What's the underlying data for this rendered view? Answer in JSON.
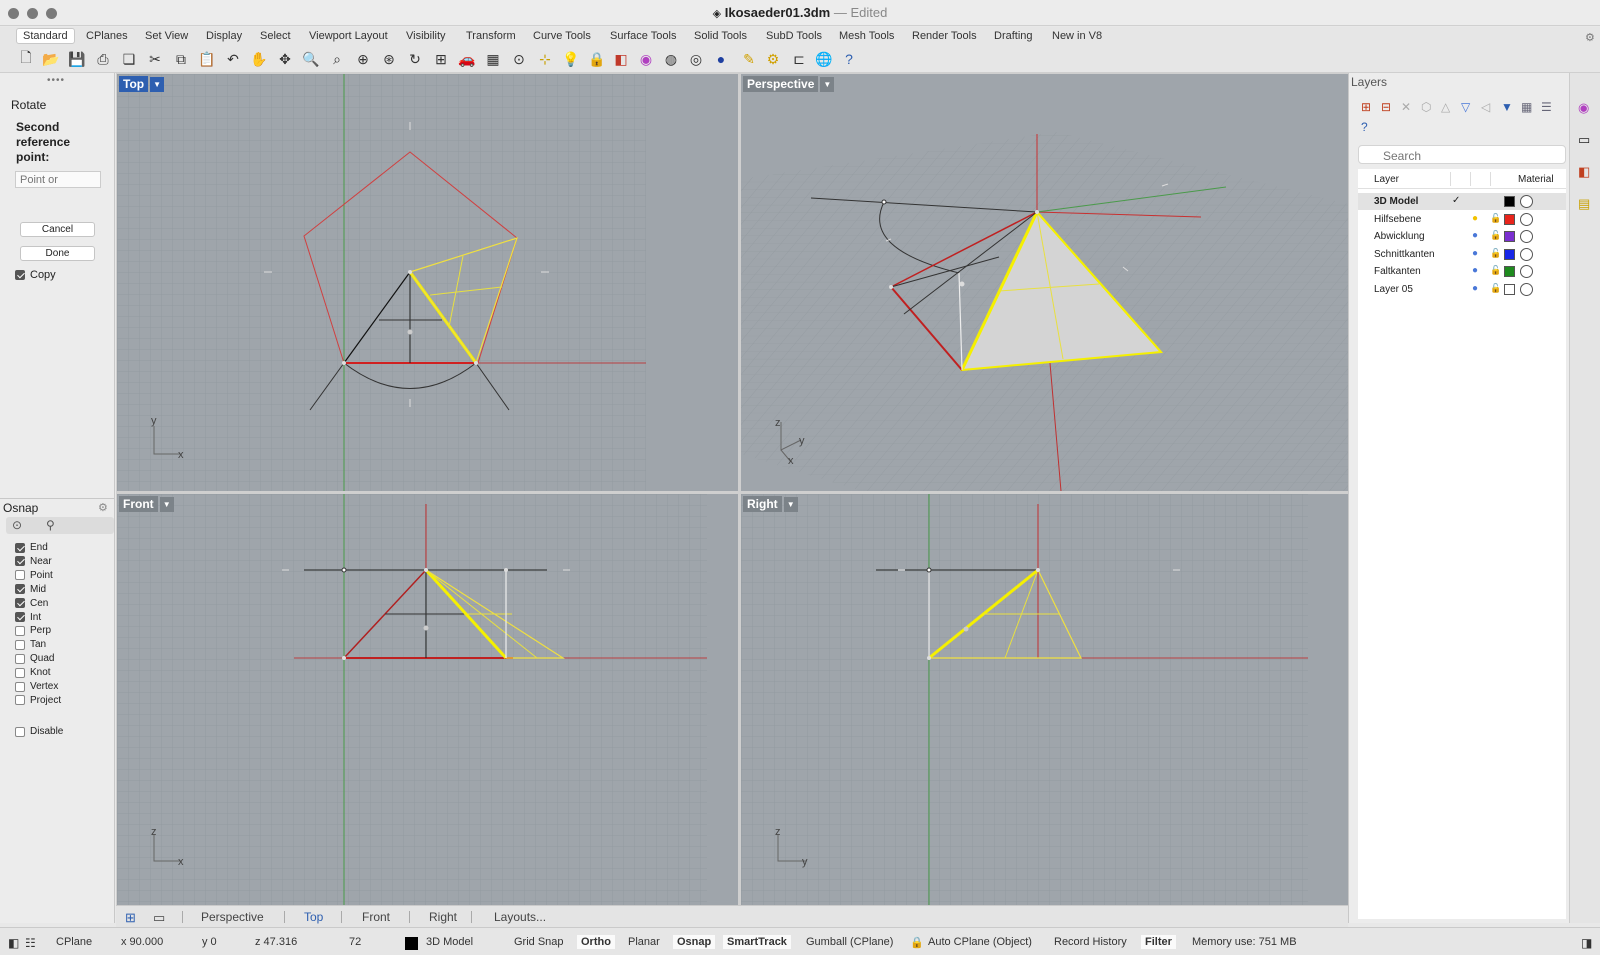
{
  "window": {
    "title": "Ikosaeder01.3dm",
    "edited": "— Edited"
  },
  "tabs": [
    "Standard",
    "CPlanes",
    "Set View",
    "Display",
    "Select",
    "Viewport Layout",
    "Visibility",
    "Transform",
    "Curve Tools",
    "Surface Tools",
    "Solid Tools",
    "SubD Tools",
    "Mesh Tools",
    "Render Tools",
    "Drafting",
    "New in V8"
  ],
  "command": {
    "name": "Rotate",
    "prompt": "Second reference point:",
    "input_placeholder": "Point or",
    "copy_label": "Copy",
    "copy_checked": true,
    "cancel": "Cancel",
    "done": "Done"
  },
  "osnap": {
    "title": "Osnap",
    "items": [
      {
        "label": "End",
        "checked": true
      },
      {
        "label": "Near",
        "checked": true
      },
      {
        "label": "Point",
        "checked": false
      },
      {
        "label": "Mid",
        "checked": true
      },
      {
        "label": "Cen",
        "checked": true
      },
      {
        "label": "Int",
        "checked": true
      },
      {
        "label": "Perp",
        "checked": false
      },
      {
        "label": "Tan",
        "checked": false
      },
      {
        "label": "Quad",
        "checked": false
      },
      {
        "label": "Knot",
        "checked": false
      },
      {
        "label": "Vertex",
        "checked": false
      },
      {
        "label": "Project",
        "checked": false
      }
    ],
    "disable": "Disable"
  },
  "viewports": {
    "top": "Top",
    "perspective": "Perspective",
    "front": "Front",
    "right": "Right"
  },
  "axes": {
    "x": "x",
    "y": "y",
    "z": "z"
  },
  "viewport_tabs": [
    "Perspective",
    "Top",
    "Front",
    "Right",
    "Layouts..."
  ],
  "layers": {
    "title": "Layers",
    "search_placeholder": "Search",
    "col_layer": "Layer",
    "col_material": "Material",
    "rows": [
      {
        "name": "3D Model",
        "current": true,
        "color": "#000000"
      },
      {
        "name": "Hilfsebene",
        "current": false,
        "color": "#e8241b",
        "bulb": "#f2c200"
      },
      {
        "name": "Abwicklung",
        "current": false,
        "color": "#7a2fd0",
        "bulb": "#4a78d8"
      },
      {
        "name": "Schnittkanten",
        "current": false,
        "color": "#1727e8",
        "bulb": "#4a78d8"
      },
      {
        "name": "Faltkanten",
        "current": false,
        "color": "#1e8a1e",
        "bulb": "#4a78d8"
      },
      {
        "name": "Layer 05",
        "current": false,
        "color": "#ffffff",
        "bulb": "#4a78d8"
      }
    ]
  },
  "status": {
    "cplane": "CPlane",
    "x": "x 90.000",
    "y": "y 0",
    "z": "z 47.316",
    "num": "72",
    "layer": "3D Model",
    "grid_snap": "Grid Snap",
    "ortho": "Ortho",
    "planar": "Planar",
    "osnap": "Osnap",
    "smarttrack": "SmartTrack",
    "gumball": "Gumball (CPlane)",
    "autocplane": "Auto CPlane (Object)",
    "record": "Record History",
    "filter": "Filter",
    "memory": "Memory use: 751 MB"
  },
  "colors": {
    "accent": "#2e5fb0",
    "viewport_bg": "#9fa5ab",
    "grid": "#929aa1",
    "red_axis": "#c0392b",
    "green_axis": "#3a9a3a",
    "highlight": "#f5f000"
  }
}
